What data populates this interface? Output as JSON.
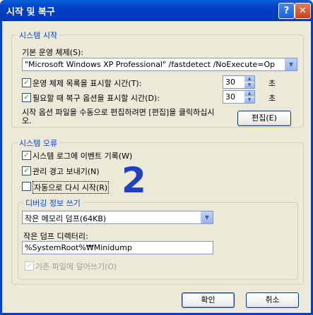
{
  "window": {
    "title": "시작 및 복구",
    "help_label": "?",
    "close_label": "✕"
  },
  "system_startup": {
    "legend": "시스템 시작",
    "default_os_label": "기본 운영 체제(S):",
    "default_os_value": "\"Microsoft Windows XP Professional\" /fastdetect /NoExecute=Op",
    "show_os_list_label": "운영 체제 목록을 표시할 시간(T):",
    "show_os_list_value": "30",
    "show_os_list_checked": true,
    "show_recovery_label": "필요할 때 복구 옵션을 표시할 시간(D):",
    "show_recovery_value": "30",
    "show_recovery_checked": true,
    "seconds_unit": "초",
    "edit_hint": "시작 옵션 파일을 수동으로 편집하려면 [편집]을 클릭하십시오.",
    "edit_button": "편집(E)"
  },
  "system_failure": {
    "legend": "시스템 오류",
    "write_event_label": "시스템 로그에 이벤트 기록(W)",
    "write_event_checked": true,
    "send_alert_label": "관리 경고 보내기(N)",
    "send_alert_checked": true,
    "auto_restart_label": "자동으로 다시 시작(R)",
    "auto_restart_checked": false,
    "annotation": "2"
  },
  "debugging": {
    "legend": "디버깅 정보 쓰기",
    "dump_type_value": "작은 메모리 덤프(64KB)",
    "dump_dir_label": "작은 덤프 디렉터리:",
    "dump_dir_value": "%SystemRoot%₩Minidump",
    "overwrite_label": "기존 파일에 덮어쓰기(O)",
    "overwrite_checked": true
  },
  "footer": {
    "ok_button": "확인",
    "cancel_button": "취소"
  }
}
